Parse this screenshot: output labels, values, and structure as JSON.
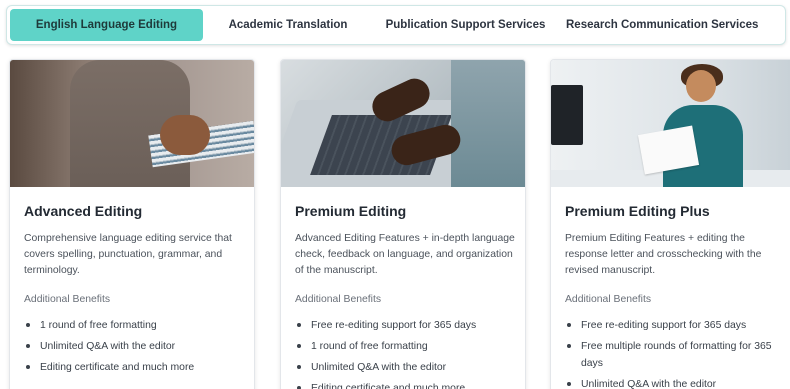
{
  "tabs": [
    {
      "label": "English Language Editing",
      "active": true
    },
    {
      "label": "Academic Translation",
      "active": false
    },
    {
      "label": "Publication Support Services",
      "active": false
    },
    {
      "label": "Research Communication Services",
      "active": false
    }
  ],
  "cards": [
    {
      "title": "Advanced Editing",
      "description": "Comprehensive language editing service that covers spelling, punctuation, grammar, and terminology.",
      "benefits_label": "Additional Benefits",
      "benefits": [
        "1 round of free formatting",
        "Unlimited Q&A with the editor",
        "Editing certificate and much more"
      ]
    },
    {
      "title": "Premium Editing",
      "description": "Advanced Editing Features + in-depth language check, feedback on language, and organization of the manuscript.",
      "benefits_label": "Additional Benefits",
      "benefits": [
        "Free re-editing support for 365 days",
        "1 round of free formatting",
        "Unlimited Q&A with the editor",
        "Editing certificate and much more"
      ]
    },
    {
      "title": "Premium Editing Plus",
      "description": "Premium Editing Features + editing the response letter and crosschecking with the revised manuscript.",
      "benefits_label": "Additional Benefits",
      "benefits": [
        "Free re-editing support for 365 days",
        "Free multiple rounds of formatting for 365 days",
        "Unlimited Q&A with the editor"
      ]
    }
  ],
  "colors": {
    "accent": "#5fd3c8"
  }
}
